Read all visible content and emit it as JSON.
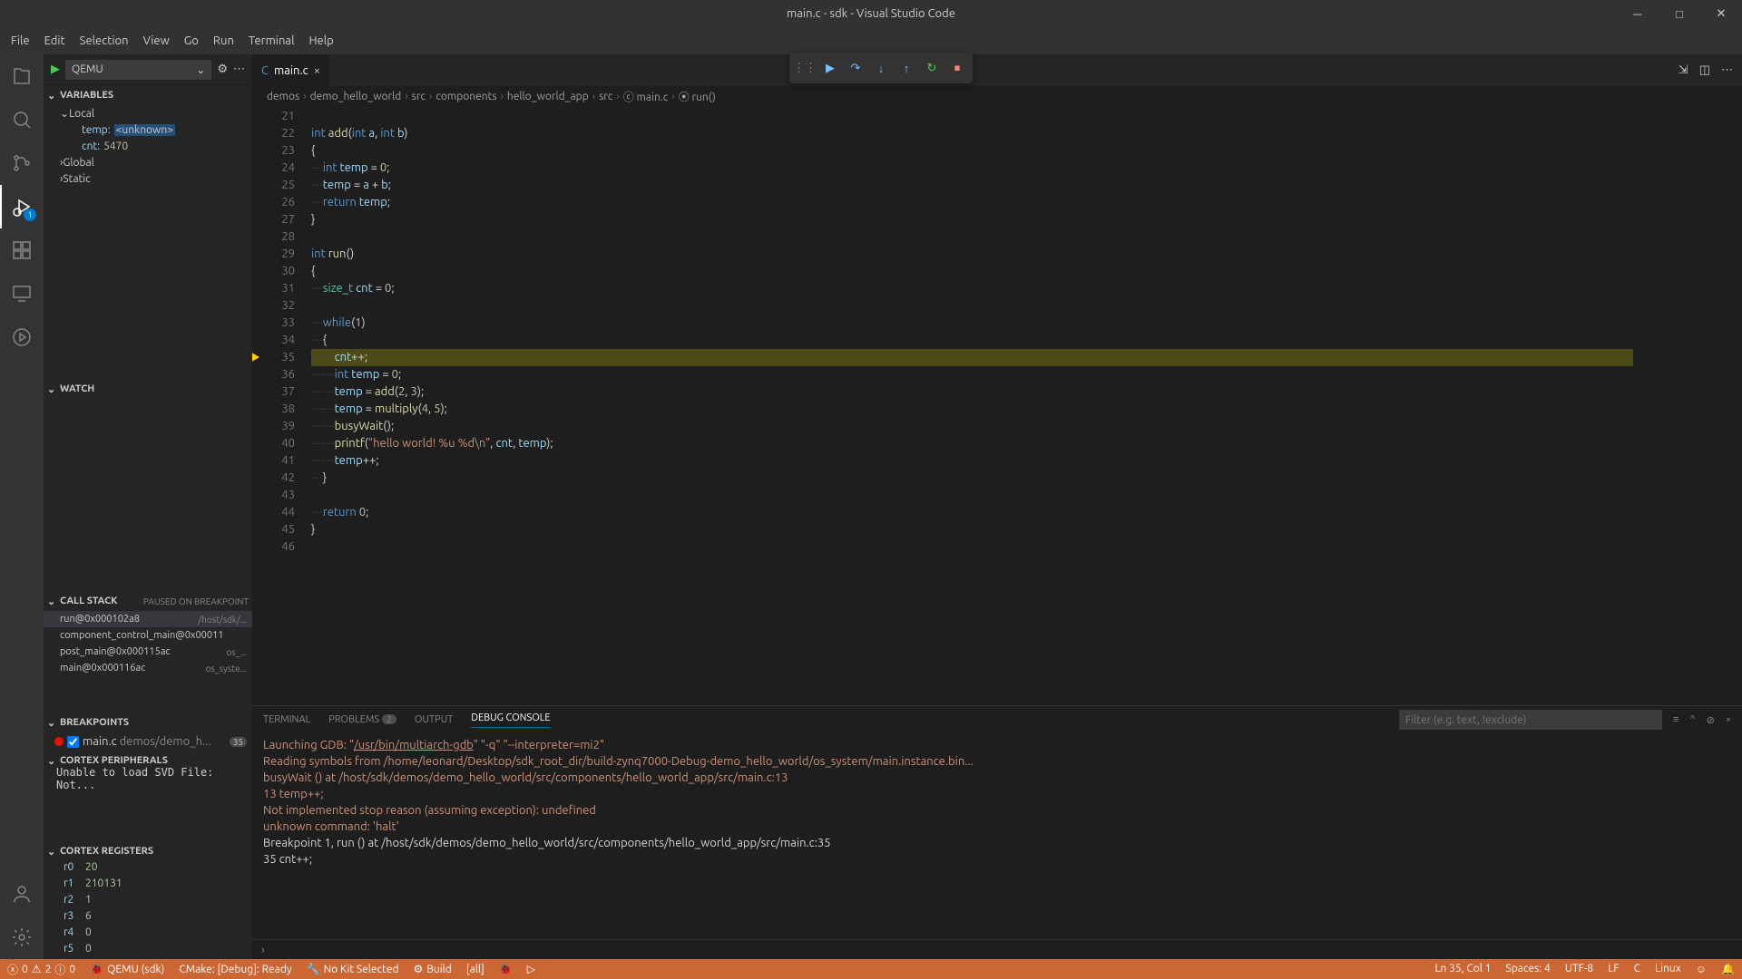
{
  "title": "main.c - sdk - Visual Studio Code",
  "menu": [
    "File",
    "Edit",
    "Selection",
    "View",
    "Go",
    "Run",
    "Terminal",
    "Help"
  ],
  "activity": {
    "debug_badge": "1"
  },
  "run_header": {
    "config": "QEMU"
  },
  "variables": {
    "title": "VARIABLES",
    "local": "Local",
    "temp_k": "temp:",
    "temp_v": "<unknown>",
    "cnt_k": "cnt:",
    "cnt_v": "5470",
    "global": "Global",
    "static": "Static"
  },
  "watch": {
    "title": "WATCH"
  },
  "callstack": {
    "title": "CALL STACK",
    "status": "PAUSED ON BREAKPOINT",
    "rows": [
      {
        "fn": "run@0x000102a8",
        "path": "/host/sdk/..."
      },
      {
        "fn": "component_control_main@0x00011",
        "path": ""
      },
      {
        "fn": "post_main@0x000115ac",
        "path": "os_..."
      },
      {
        "fn": "main@0x000116ac",
        "path": "os_syste..."
      }
    ]
  },
  "breakpoints": {
    "title": "BREAKPOINTS",
    "file": "main.c",
    "loc": "demos/demo_h...",
    "line": "35"
  },
  "cortex_p": {
    "title": "CORTEX PERIPHERALS",
    "msg": "Unable to load SVD File: Not..."
  },
  "cortex_r": {
    "title": "CORTEX REGISTERS",
    "regs": [
      [
        "r0",
        "20"
      ],
      [
        "r1",
        "210131"
      ],
      [
        "r2",
        "1"
      ],
      [
        "r3",
        "6"
      ],
      [
        "r4",
        "0"
      ],
      [
        "r5",
        "0"
      ]
    ]
  },
  "tab": {
    "name": "main.c"
  },
  "breadcrumbs": [
    "demos",
    "demo_hello_world",
    "src",
    "components",
    "hello_world_app",
    "src",
    "main.c",
    "run()"
  ],
  "lines": {
    "start": 21,
    "highlight": 35,
    "end": 46
  },
  "panel": {
    "tabs": {
      "terminal": "TERMINAL",
      "problems": "PROBLEMS",
      "problems_n": "2",
      "output": "OUTPUT",
      "debug": "DEBUG CONSOLE"
    },
    "filter_ph": "Filter (e.g. text, !exclude)",
    "lines": [
      {
        "t": "Launching GDB: ",
        "c": "o",
        "cont": [
          {
            "t": "\"",
            "c": "o"
          },
          {
            "t": "/usr/bin/multiarch-gdb",
            "c": "o u"
          },
          {
            "t": "\" \"-q\" \"--interpreter=mi2\"",
            "c": "o"
          }
        ]
      },
      {
        "t": "Reading symbols from /home/leonard/Desktop/sdk_root_dir/build-zynq7000-Debug-demo_hello_world/os_system/main.instance.bin...",
        "c": "o"
      },
      {
        "t": "busyWait () at /host/sdk/demos/demo_hello_world/src/components/hello_world_app/src/main.c:13",
        "c": "o"
      },
      {
        "t": "13              temp++;",
        "c": "o"
      },
      {
        "t": "Not implemented stop reason (assuming exception): undefined",
        "c": "o"
      },
      {
        "t": "unknown command: 'halt'",
        "c": "o"
      },
      {
        "t": "",
        "c": "o"
      },
      {
        "t": "Breakpoint 1, run () at /host/sdk/demos/demo_hello_world/src/components/hello_world_app/src/main.c:35",
        "c": "w"
      },
      {
        "t": "35              cnt++;",
        "c": "w"
      }
    ]
  },
  "status": {
    "err": "0",
    "warn": "2",
    "info": "0",
    "items": [
      "QEMU (sdk)",
      "CMake: [Debug]: Ready",
      "No Kit Selected",
      "Build",
      "[all]"
    ],
    "right": [
      "Ln 35, Col 1",
      "Spaces: 4",
      "UTF-8",
      "LF",
      "C",
      "Linux"
    ]
  },
  "chart_data": null
}
